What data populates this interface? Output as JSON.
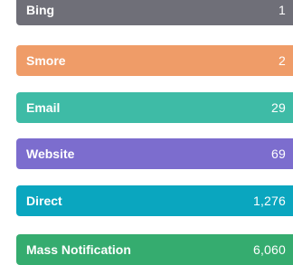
{
  "sources": [
    {
      "label": "Bing",
      "count": "1",
      "color": "#6f6f78"
    },
    {
      "label": "Smore",
      "count": "2",
      "color": "#ef9c68"
    },
    {
      "label": "Email",
      "count": "29",
      "color": "#3ebba6"
    },
    {
      "label": "Website",
      "count": "69",
      "color": "#7c6dce"
    },
    {
      "label": "Direct",
      "count": "1,276",
      "color": "#0aa6bf"
    },
    {
      "label": "Mass Notification",
      "count": "6,060",
      "color": "#35ac6f"
    }
  ]
}
